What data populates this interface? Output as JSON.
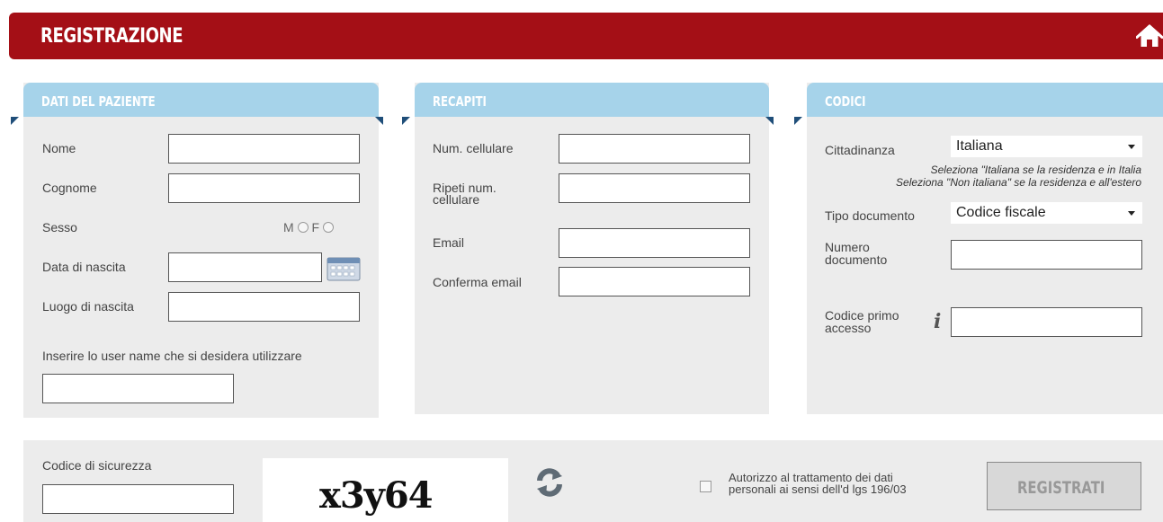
{
  "header": {
    "title": "REGISTRAZIONE",
    "home_icon": "home-icon"
  },
  "panel_paziente": {
    "title": "DATI DEL PAZIENTE",
    "nome_label": "Nome",
    "cognome_label": "Cognome",
    "sesso_label": "Sesso",
    "sesso_m": "M",
    "sesso_f": "F",
    "data_nascita_label": "Data di nascita",
    "calendar_icon": "calendar-icon",
    "luogo_nascita_label": "Luogo di nascita",
    "username_label": "Inserire lo user name che si desidera utilizzare",
    "values": {
      "nome": "",
      "cognome": "",
      "data_nascita": "",
      "luogo_nascita": "",
      "username": ""
    }
  },
  "panel_recapiti": {
    "title": "RECAPITI",
    "cellulare_label": "Num. cellulare",
    "ripeti_cellulare_label_1": "Ripeti num.",
    "ripeti_cellulare_label_2": "cellulare",
    "email_label": "Email",
    "conferma_email_label": "Conferma email",
    "values": {
      "cellulare": "",
      "ripeti_cellulare": "",
      "email": "",
      "conferma_email": ""
    }
  },
  "panel_codici": {
    "title": "CODICI",
    "cittadinanza_label": "Cittadinanza",
    "cittadinanza_value": "Italiana",
    "hint_1": "Seleziona \"Italiana se la residenza e in Italia",
    "hint_2": "Seleziona \"Non italiana\" se la residenza e all'estero",
    "tipo_documento_label": "Tipo documento",
    "tipo_documento_value": "Codice fiscale",
    "numero_documento_label_1": "Numero",
    "numero_documento_label_2": "documento",
    "codice_primo_label_1": "Codice primo",
    "codice_primo_label_2": "accesso",
    "info_icon": "info-icon",
    "values": {
      "numero_documento": "",
      "codice_primo_accesso": ""
    }
  },
  "footer": {
    "codice_sicurezza_label": "Codice di sicurezza",
    "captcha_text": "x3y64",
    "refresh_icon": "refresh-icon",
    "consenso_label_1": "Autorizzo al trattamento dei dati",
    "consenso_label_2": "personali ai sensi dell'd lgs 196/03",
    "consenso_checked": false,
    "submit_label": "REGISTRATI",
    "values": {
      "codice_sicurezza": ""
    }
  },
  "colors": {
    "header_bg": "#a40f16",
    "panel_header_bg": "#a6d3ea",
    "panel_bg": "#ececec",
    "fold": "#1f4e79"
  }
}
